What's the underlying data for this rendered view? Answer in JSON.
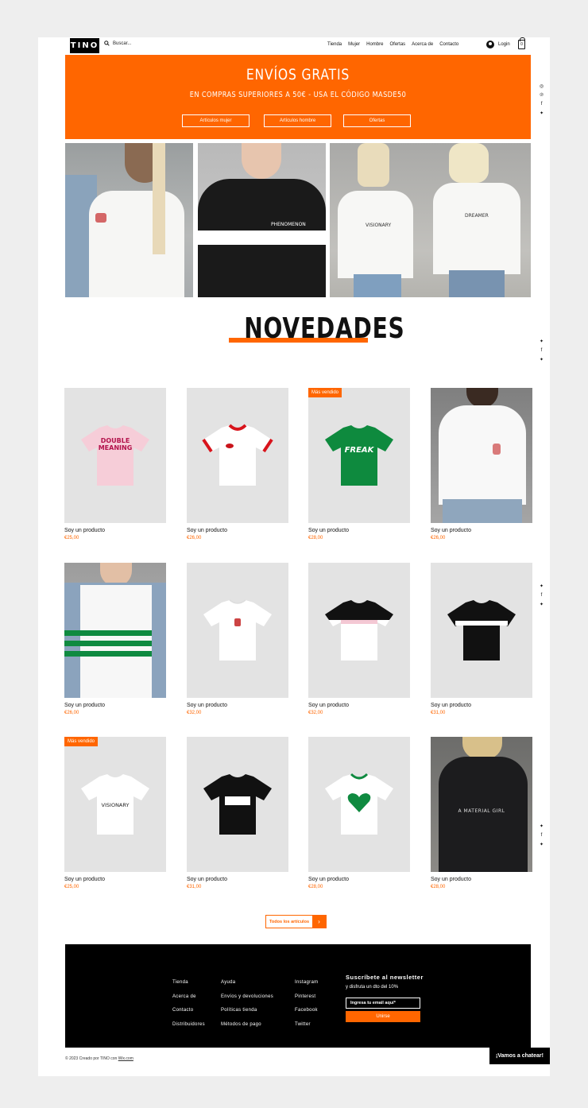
{
  "header": {
    "logo": "TINO",
    "search_placeholder": "Buscar...",
    "nav": [
      "Tienda",
      "Mujer",
      "Hombre",
      "Ofertas",
      "Acerca de",
      "Contacto"
    ],
    "login": "Login",
    "cart_count": "0"
  },
  "banner": {
    "title": "ENVÍOS GRATIS",
    "subtitle": "EN COMPRAS SUPERIORES A 50€ - USA EL CÓDIGO MASDE50",
    "buttons": [
      "Artículos mujer",
      "Artículos hombre",
      "Ofertas"
    ]
  },
  "hero": {
    "shirt_labels": [
      "PHENOMENON",
      "VISIONARY",
      "DREAMER"
    ]
  },
  "section_title": "NOVEDADES",
  "products": [
    {
      "name": "Soy un producto",
      "price": "€25,00",
      "badge": "",
      "print": "DOUBLE MEANING"
    },
    {
      "name": "Soy un producto",
      "price": "€26,00",
      "badge": "",
      "print": ""
    },
    {
      "name": "Soy un producto",
      "price": "€28,00",
      "badge": "Más vendido",
      "print": "FREAK"
    },
    {
      "name": "Soy un producto",
      "price": "€26,00",
      "badge": "",
      "print": ""
    },
    {
      "name": "Soy un producto",
      "price": "€26,00",
      "badge": "",
      "print": ""
    },
    {
      "name": "Soy un producto",
      "price": "€32,00",
      "badge": "",
      "print": ""
    },
    {
      "name": "Soy un producto",
      "price": "€32,00",
      "badge": "",
      "print": ""
    },
    {
      "name": "Soy un producto",
      "price": "€31,00",
      "badge": "",
      "print": ""
    },
    {
      "name": "Soy un producto",
      "price": "€25,00",
      "badge": "Más vendido",
      "print": "VISIONARY"
    },
    {
      "name": "Soy un producto",
      "price": "€31,00",
      "badge": "",
      "print": "NATIVE"
    },
    {
      "name": "Soy un producto",
      "price": "€28,00",
      "badge": "",
      "print": ""
    },
    {
      "name": "Soy un producto",
      "price": "€28,00",
      "badge": "",
      "print": "A MATERIAL GIRL"
    }
  ],
  "all_button": "Todos los artículos",
  "footer": {
    "col1": [
      "Tienda",
      "Acerca de",
      "Contacto",
      "Distribuidores"
    ],
    "col2": [
      "Ayuda",
      "Envíos y devoluciones",
      "Políticas tienda",
      "Métodos de pago"
    ],
    "col3": [
      "Instagram",
      "Pinterest",
      "Facebook",
      "Twitter"
    ],
    "newsletter_title": "Suscríbete al newsletter",
    "newsletter_sub": "y disfruta un dto del 10%",
    "newsletter_placeholder": "Ingresa tu email aquí*",
    "newsletter_button": "Unirse"
  },
  "copyright_prefix": "© 2023 Creado por TINO con ",
  "copyright_link": "Wix.com",
  "chat_button": "¡Vamos a chatear!",
  "colors": {
    "accent": "#ff6600",
    "footer_bg": "#000000",
    "card_bg": "#e3e3e3"
  }
}
